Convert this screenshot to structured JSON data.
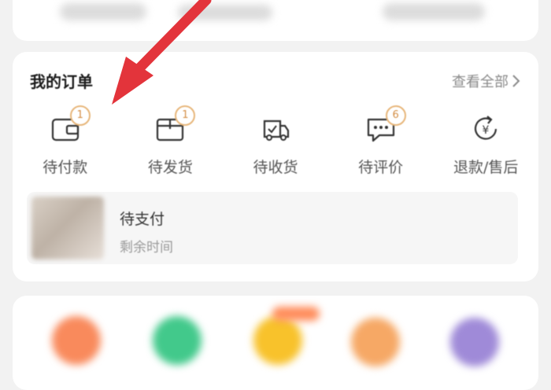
{
  "orders": {
    "title": "我的订单",
    "view_all": "查看全部",
    "statuses": [
      {
        "label": "待付款",
        "badge": "1",
        "icon": "wallet-icon"
      },
      {
        "label": "待发货",
        "badge": "1",
        "icon": "package-icon"
      },
      {
        "label": "待收货",
        "badge": "",
        "icon": "truck-icon"
      },
      {
        "label": "待评价",
        "badge": "6",
        "icon": "chat-icon"
      },
      {
        "label": "退款/售后",
        "badge": "",
        "icon": "refund-icon"
      }
    ],
    "pending": {
      "title": "待支付",
      "subtitle": "剩余时间"
    }
  },
  "colors": {
    "arrow": "#e3343b",
    "badge_border": "#e7b67a",
    "badge_text": "#d48e45"
  }
}
